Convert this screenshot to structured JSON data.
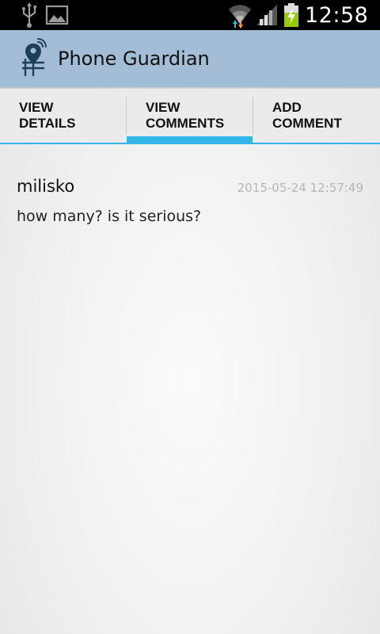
{
  "status_bar": {
    "time": "12:58",
    "icons": [
      "usb-icon",
      "image-icon",
      "wifi-icon",
      "signal-icon",
      "battery-charging-icon"
    ]
  },
  "action_bar": {
    "app_icon": "phone-guardian-logo-icon",
    "title": "Phone Guardian"
  },
  "tabs": [
    {
      "label": "VIEW\nDETAILS",
      "selected": false
    },
    {
      "label": "VIEW\nCOMMENTS",
      "selected": true
    },
    {
      "label": "ADD\nCOMMENT",
      "selected": false
    }
  ],
  "accent_color": "#33b5e5",
  "action_bar_color": "#a3bdd6",
  "comments": [
    {
      "author": "milisko",
      "date": "2015-05-24 12:57:49",
      "text": "how many? is it serious?"
    }
  ]
}
